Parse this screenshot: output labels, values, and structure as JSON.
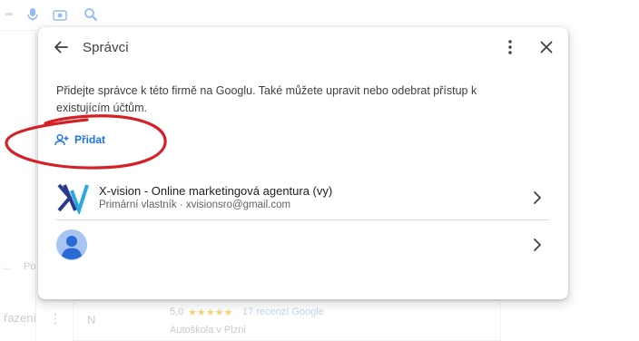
{
  "background": {
    "left_fragment_1": "...",
    "left_fragment_2": "Po",
    "sort_label": "řazení",
    "card_letter": "N",
    "rating": "5,0",
    "stars": "★★★★★",
    "reviews": "17 recenzí Google",
    "category": "Autoškola v Plzni"
  },
  "dialog": {
    "title": "Správci",
    "description": "Přidejte správce k této firmě na Googlu. Také můžete upravit nebo odebrat přístup k existujícím účtům.",
    "add_label": "Přidat",
    "managers": [
      {
        "name": "X-vision - Online marketingová agentura (vy)",
        "role": "Primární vlastník · xvisionsro@gmail.com",
        "icon": "xv-logo-icon"
      },
      {
        "name": "",
        "role": "",
        "icon": "person-avatar-icon"
      }
    ]
  },
  "colors": {
    "accent": "#1a73e8",
    "annotation": "#d62027",
    "text": "#202124",
    "secondary_text": "#5f6368"
  }
}
